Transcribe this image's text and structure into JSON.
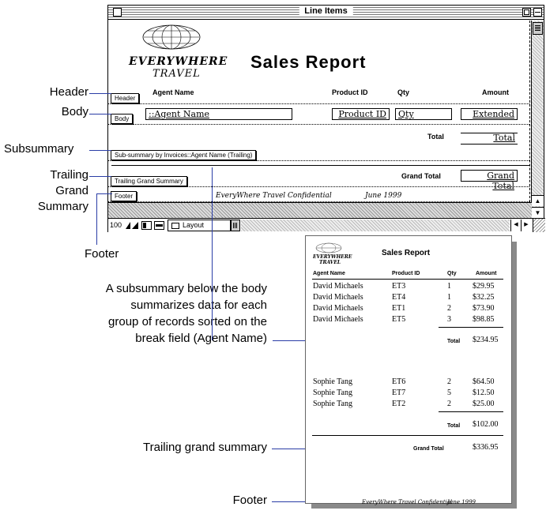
{
  "window": {
    "title": "Line Items",
    "zoom": "100",
    "mode": "Layout"
  },
  "layout": {
    "logo_line1": "EVERYWHERE",
    "logo_line2": "TRAVEL",
    "report_title": "Sales Report",
    "col_agent": "Agent Name",
    "col_product": "Product ID",
    "col_qty": "Qty",
    "col_amount": "Amount",
    "parts": {
      "header": "Header",
      "body": "Body",
      "subsummary": "Sub-summary by Invoices::Agent Name (Trailing)",
      "trailing_grand": "Trailing Grand Summary",
      "footer": "Footer"
    },
    "fields": {
      "agent": "::Agent Name",
      "product": "Product ID",
      "qty": "Qty",
      "extended": "Extended",
      "total": "Total",
      "grand_total": "Grand Total"
    },
    "total_label": "Total",
    "grand_total_label": "Grand Total",
    "footer_text": "EveryWhere Travel Confidential",
    "footer_date": "June 1999"
  },
  "callouts": {
    "header": "Header",
    "body": "Body",
    "subsummary": "Subsummary",
    "trailing_grand_lines": [
      "Trailing",
      "Grand",
      "Summary"
    ],
    "footer": "Footer",
    "subsummary_desc_lines": [
      "A subsummary below the body",
      "summarizes data for each",
      "group of records sorted on the",
      "break field (Agent Name)"
    ],
    "trailing_grand_desc": "Trailing grand summary",
    "footer_desc": "Footer"
  },
  "sample": {
    "logo_line1": "EVERYWHERE",
    "logo_line2": "TRAVEL",
    "title": "Sales Report",
    "headers": [
      "Agent Name",
      "Product ID",
      "Qty",
      "Amount"
    ],
    "group1": [
      [
        "David Michaels",
        "ET3",
        "1",
        "$29.95"
      ],
      [
        "David Michaels",
        "ET4",
        "1",
        "$32.25"
      ],
      [
        "David Michaels",
        "ET1",
        "2",
        "$73.90"
      ],
      [
        "David Michaels",
        "ET5",
        "3",
        "$98.85"
      ]
    ],
    "group1_total_label": "Total",
    "group1_total": "$234.95",
    "group2": [
      [
        "Sophie Tang",
        "ET6",
        "2",
        "$64.50"
      ],
      [
        "Sophie Tang",
        "ET7",
        "5",
        "$12.50"
      ],
      [
        "Sophie Tang",
        "ET2",
        "2",
        "$25.00"
      ]
    ],
    "group2_total_label": "Total",
    "group2_total": "$102.00",
    "grand_total_label": "Grand Total",
    "grand_total": "$336.95",
    "footer_text": "EveryWhere Travel Confidential",
    "footer_date": "June 1999"
  }
}
